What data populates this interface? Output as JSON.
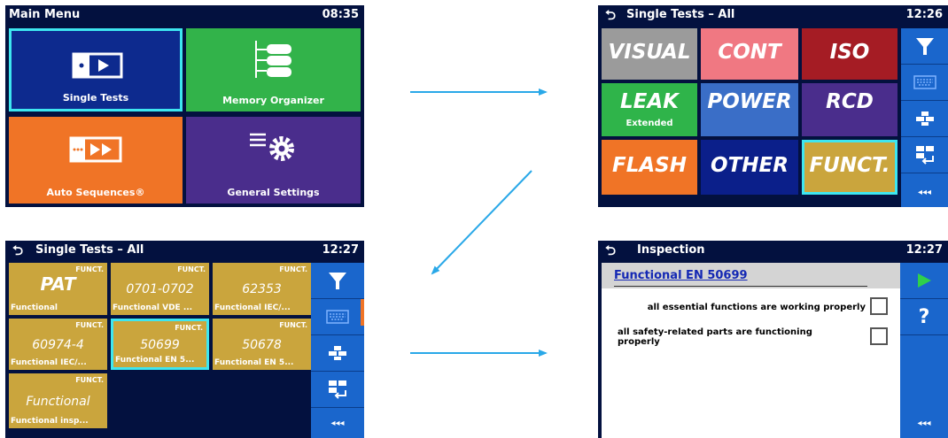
{
  "main_menu": {
    "title": "Main Menu",
    "time": "08:35",
    "tiles": [
      {
        "label": "Single Tests",
        "color": "#0d2a8e",
        "icon": "single-tests-icon"
      },
      {
        "label": "Memory Organizer",
        "color": "#32b34a",
        "icon": "memory-tree-icon"
      },
      {
        "label": "Auto Sequences®",
        "color": "#f07426",
        "icon": "auto-sequence-icon"
      },
      {
        "label": "General Settings",
        "color": "#4a2d8c",
        "icon": "settings-gear-icon"
      }
    ]
  },
  "single_tests_all": {
    "back": "⮌",
    "title": "Single Tests – All",
    "time": "12:26",
    "tiles": [
      {
        "label": "VISUAL",
        "sub": "",
        "color": "#9b9b9b"
      },
      {
        "label": "CONT",
        "sub": "",
        "color": "#f07882"
      },
      {
        "label": "ISO",
        "sub": "",
        "color": "#a51c24"
      },
      {
        "label": "LEAK",
        "sub": "Extended",
        "color": "#2fb44a"
      },
      {
        "label": "POWER",
        "sub": "",
        "color": "#3a6ec7"
      },
      {
        "label": "RCD",
        "sub": "",
        "color": "#4a2d8c"
      },
      {
        "label": "FLASH",
        "sub": "",
        "color": "#f07426"
      },
      {
        "label": "OTHER",
        "sub": "",
        "color": "#0b1f8a"
      },
      {
        "label": "FUNCT.",
        "sub": "",
        "color": "#caa53d"
      }
    ],
    "sidebar_more": "◂◂◂"
  },
  "single_tests_funct": {
    "back": "⮌",
    "title": "Single Tests – All",
    "time": "12:27",
    "tiles": [
      {
        "header": "FUNCT.",
        "name": "PAT",
        "label": "Functional"
      },
      {
        "header": "FUNCT.",
        "name": "0701-0702",
        "label": "Functional VDE ..."
      },
      {
        "header": "FUNCT.",
        "name": "62353",
        "label": "Functional IEC/..."
      },
      {
        "header": "FUNCT.",
        "name": "60974-4",
        "label": "Functional IEC/..."
      },
      {
        "header": "FUNCT.",
        "name": "50699",
        "label": "Functional EN 5..."
      },
      {
        "header": "FUNCT.",
        "name": "50678",
        "label": "Functional EN 5..."
      },
      {
        "header": "FUNCT.",
        "name": "Functional",
        "label": "Functional insp..."
      }
    ],
    "sidebar_more": "◂◂◂"
  },
  "inspection": {
    "back": "⮌",
    "title": "Inspection",
    "time": "12:27",
    "heading": "Functional EN 50699",
    "items": [
      {
        "text": "all essential functions are working properly"
      },
      {
        "text": "all safety-related parts are functioning properly"
      }
    ],
    "help": "?",
    "sidebar_more": "◂◂◂"
  },
  "colors": {
    "screen_bg": "#03113f",
    "sidebar": "#1a66cc",
    "arrow": "#29a8e8",
    "selection": "#3ee6f0",
    "funct_tile": "#caa53d"
  }
}
